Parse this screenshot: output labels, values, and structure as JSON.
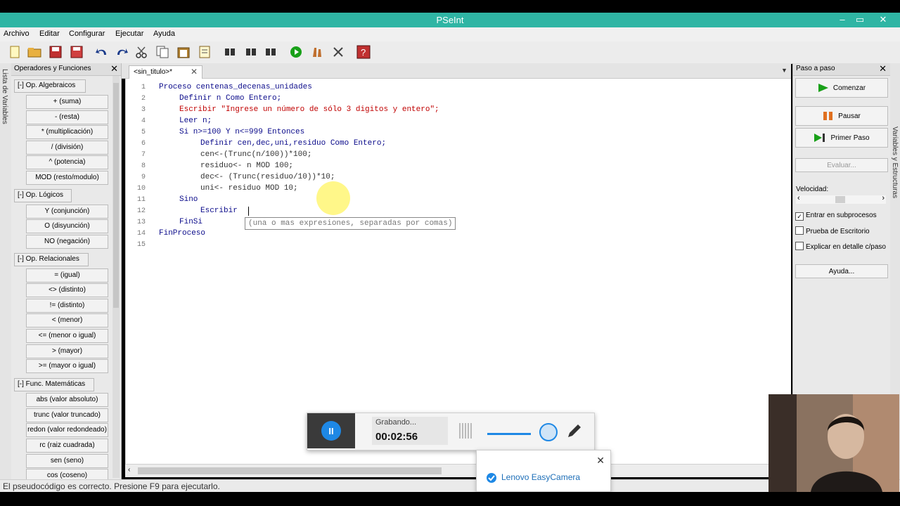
{
  "window": {
    "title": "PSeInt",
    "controls": [
      "–",
      "▭",
      "✕"
    ]
  },
  "menu": [
    "Archivo",
    "Editar",
    "Configurar",
    "Ejecutar",
    "Ayuda"
  ],
  "left_strip_label": "Lista de Variables",
  "left_panel": {
    "title": "Operadores y Funciones",
    "close": "✕",
    "groups": [
      {
        "label": "[-]  Op. Algebraicos",
        "items": [
          "+ (suma)",
          "- (resta)",
          "* (multiplicación)",
          "/ (división)",
          "^ (potencia)",
          "MOD (resto/modulo)"
        ]
      },
      {
        "label": "[-]  Op. Lógicos",
        "items": [
          "Y (conjunción)",
          "O (disyunción)",
          "NO (negación)"
        ]
      },
      {
        "label": "[-]  Op. Relacionales",
        "items": [
          "= (igual)",
          "<> (distinto)",
          "!= (distinto)",
          "< (menor)",
          "<= (menor o igual)",
          "> (mayor)",
          ">= (mayor o igual)"
        ]
      },
      {
        "label": "[-]  Func. Matemáticas",
        "items": [
          "abs (valor absoluto)",
          "trunc (valor truncado)",
          "redon (valor redondeado)",
          "rc (raiz cuadrada)",
          "sen (seno)",
          "cos (coseno)"
        ]
      }
    ]
  },
  "editor": {
    "tab_label": "<sin_titulo>*",
    "tab_close": "✕",
    "line_numbers": [
      "1",
      "2",
      "3",
      "4",
      "5",
      "6",
      "7",
      "8",
      "9",
      "10",
      "11",
      "12",
      "13",
      "14",
      "15"
    ],
    "lines": [
      "Proceso centenas_decenas_unidades",
      "Definir n Como Entero;",
      "Escribir \"Ingrese un número de sólo 3 digitos y entero\";",
      "Leer n;",
      "Si n>=100 Y n<=999 Entonces",
      "Definir cen,dec,uni,residuo Como Entero;",
      "cen<-(Trunc(n/100))*100;",
      "residuo<- n MOD 100;",
      "dec<- (Trunc(residuo/10))*10;",
      "uni<- residuo MOD 10;",
      "Sino",
      "Escribir",
      "FinSi",
      "FinProceso",
      ""
    ],
    "hint": "(una o mas expresiones, separadas por comas)"
  },
  "status": "El pseudocódigo es correcto. Presione F9 para ejecutarlo.",
  "right_panel": {
    "title": "Paso a paso",
    "close": "✕",
    "buttons": [
      "Comenzar",
      "Pausar",
      "Primer Paso"
    ],
    "evaluate": "Evaluar...",
    "speed_label": "Velocidad:",
    "checks": [
      {
        "label": "Entrar en subprocesos",
        "checked": true
      },
      {
        "label": "Prueba de Escritorio",
        "checked": false
      },
      {
        "label": "Explicar en detalle c/paso",
        "checked": false
      }
    ],
    "help": "Ayuda..."
  },
  "right_strip_label": "Variables y Estructuras",
  "recorder": {
    "status": "Grabando...",
    "time": "00:02:56"
  },
  "toast": {
    "text": "Lenovo EasyCamera",
    "close": "✕"
  },
  "colors": {
    "titlebar": "#2fb5a4",
    "keyword": "#0a0a8a",
    "string": "#c00000",
    "accent": "#1e88e5"
  }
}
